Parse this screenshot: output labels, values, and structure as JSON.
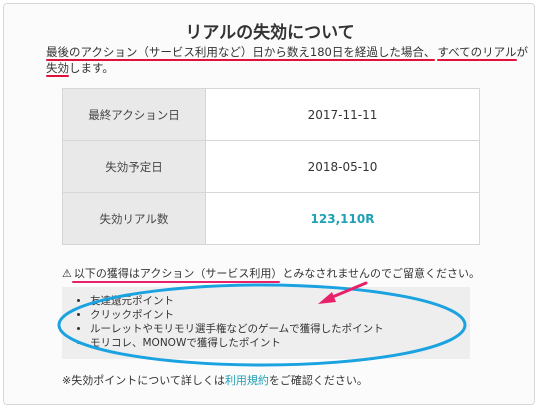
{
  "title": "リアルの失効について",
  "intro": {
    "line1_a": "最後のアクション（サービス利用など）日から数え180日を経過した場合、",
    "line1_b": "すべてのリアル",
    "line1_c": "が",
    "line2_a": "失効",
    "line2_b": "します。"
  },
  "table": {
    "rows": [
      {
        "label": "最終アクション日",
        "value": "2017-11-11"
      },
      {
        "label": "失効予定日",
        "value": "2018-05-10"
      },
      {
        "label": "失効リアル数",
        "value": "123,110R"
      }
    ]
  },
  "notice": {
    "icon": "warning-icon",
    "pre": "以下の獲得はアクション（サービス利用）",
    "post": "とみなされませんのでご留意ください。"
  },
  "list": [
    "友達還元ポイント",
    "クリックポイント",
    "ルーレットやモリモリ選手権などのゲームで獲得したポイント",
    "モリコレ、MONOWで獲得したポイント"
  ],
  "footnote": {
    "pre": "※失効ポイントについて詳しくは",
    "link": "利用規約",
    "post": "をご確認ください。"
  },
  "colors": {
    "accent": "#1fa0b5",
    "red_underline": "#e0113a",
    "pink_arrow": "#e8226a",
    "ellipse": "#1aa3e0"
  }
}
